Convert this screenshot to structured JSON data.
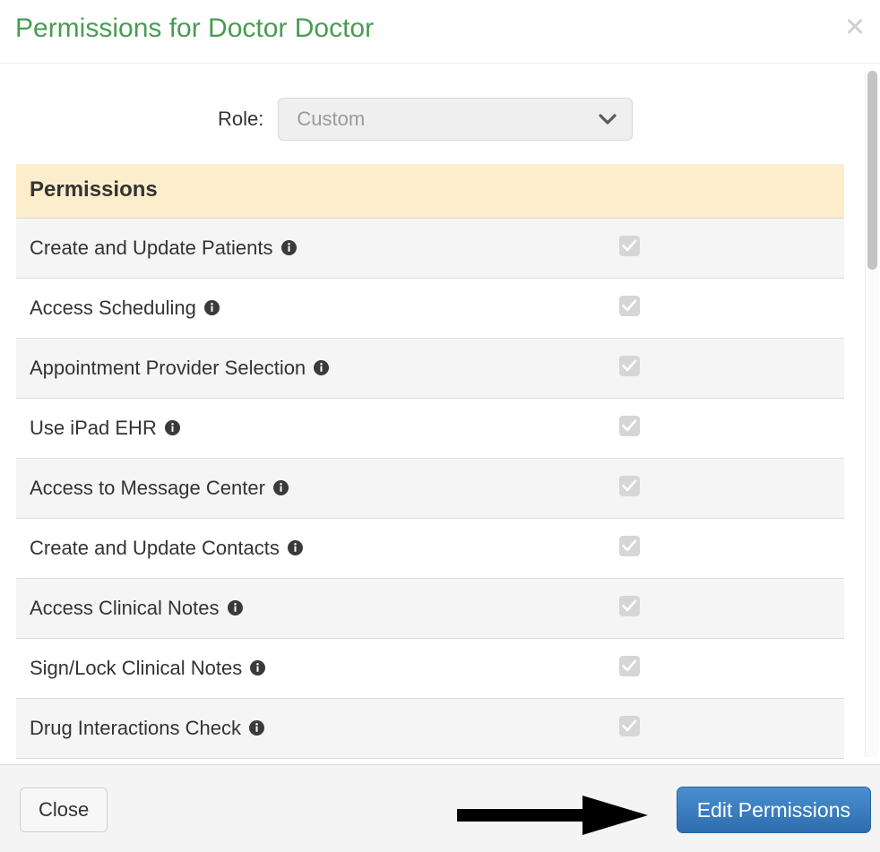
{
  "modal": {
    "title": "Permissions for Doctor Doctor",
    "close_icon_label": "✕",
    "accent_title_color": "#4a9b52"
  },
  "role": {
    "label": "Role:",
    "selected": "Custom",
    "disabled": true,
    "chevron_icon": "chevron-down-icon"
  },
  "permissions": {
    "header": "Permissions",
    "header_bg": "#fceecd",
    "info_icon": "info-icon",
    "rows": [
      {
        "label": "Create and Update Patients",
        "checked": true
      },
      {
        "label": "Access Scheduling",
        "checked": true
      },
      {
        "label": "Appointment Provider Selection",
        "checked": true
      },
      {
        "label": "Use iPad EHR",
        "checked": true
      },
      {
        "label": "Access to Message Center",
        "checked": true
      },
      {
        "label": "Create and Update Contacts",
        "checked": true
      },
      {
        "label": "Access Clinical Notes",
        "checked": true
      },
      {
        "label": "Sign/Lock Clinical Notes",
        "checked": true
      },
      {
        "label": "Drug Interactions Check",
        "checked": true
      }
    ]
  },
  "footer": {
    "close_label": "Close",
    "edit_label": "Edit Permissions",
    "edit_button_color": "#3a7bbf"
  },
  "annotation": {
    "arrow": "right-arrow",
    "color": "#000000"
  }
}
